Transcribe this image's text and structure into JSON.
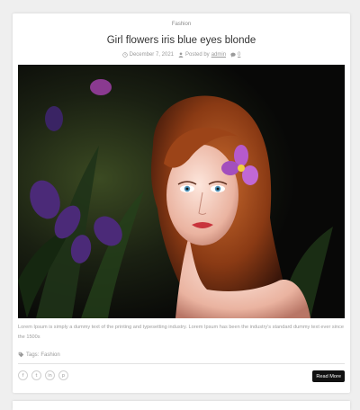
{
  "post": {
    "category": "Fashion",
    "title": "Girl flowers iris blue eyes blonde",
    "date": "December 7, 2021",
    "posted_by_label": "Posted by",
    "author": "admin",
    "comment_count": "0",
    "excerpt": "Lorem Ipsum is simply a dummy text of the printing and typesetting industry. Lorem Ipsum has been the industry's standard dummy text ever since the 1500s",
    "tags_label": "Tags:",
    "tag": "Fashion",
    "read_more_label": "Read More"
  },
  "social": [
    {
      "icon": "facebook-icon",
      "glyph": "f"
    },
    {
      "icon": "twitter-icon",
      "glyph": "t"
    },
    {
      "icon": "linkedin-icon",
      "glyph": "in"
    },
    {
      "icon": "pinterest-icon",
      "glyph": "p"
    }
  ],
  "colors": {
    "background": "#efefef",
    "card": "#ffffff",
    "button": "#111111",
    "text_muted": "#9a9a9a",
    "title": "#333333"
  }
}
